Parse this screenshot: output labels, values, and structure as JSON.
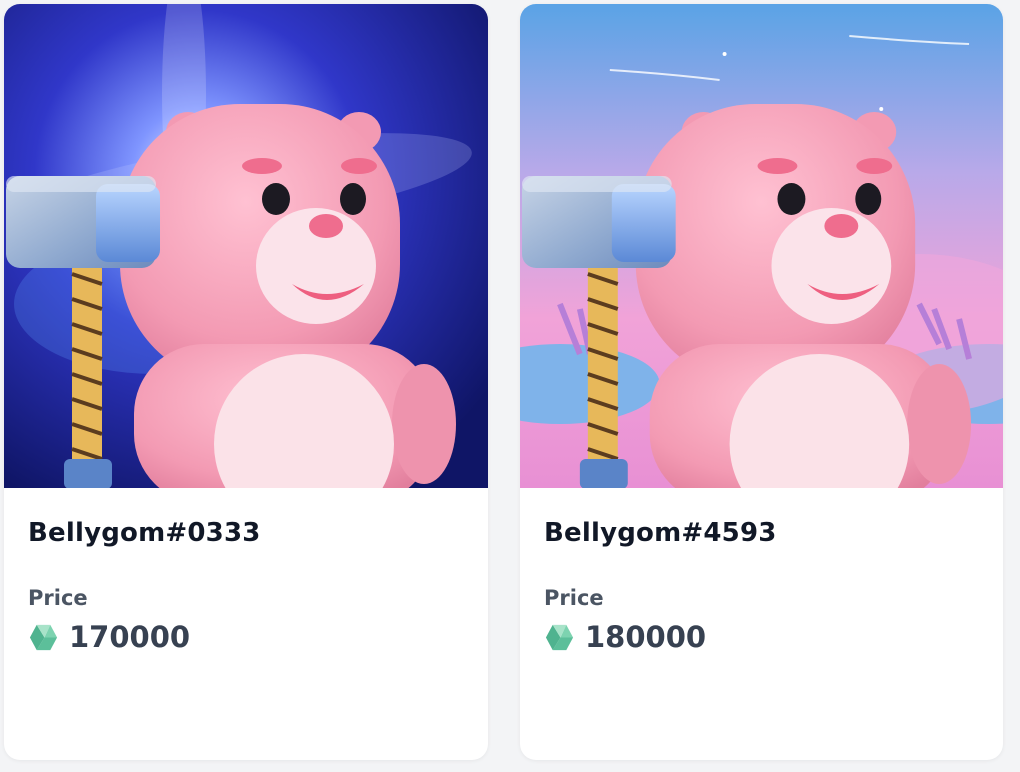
{
  "cards": [
    {
      "name": "Bellygom#0333",
      "price_label": "Price",
      "price_value": "170000",
      "currency_icon": "klaytn-icon",
      "art_theme": "space-blue"
    },
    {
      "name": "Bellygom#4593",
      "price_label": "Price",
      "price_value": "180000",
      "currency_icon": "klaytn-icon",
      "art_theme": "pink-sky"
    }
  ],
  "colors": {
    "bear": "#f19bb3",
    "bear_belly": "#fbe2e8",
    "hammer_head": "#8fb6e6",
    "hammer_handle": "#e7b85a",
    "klay_icon": "#5cbf9a"
  }
}
